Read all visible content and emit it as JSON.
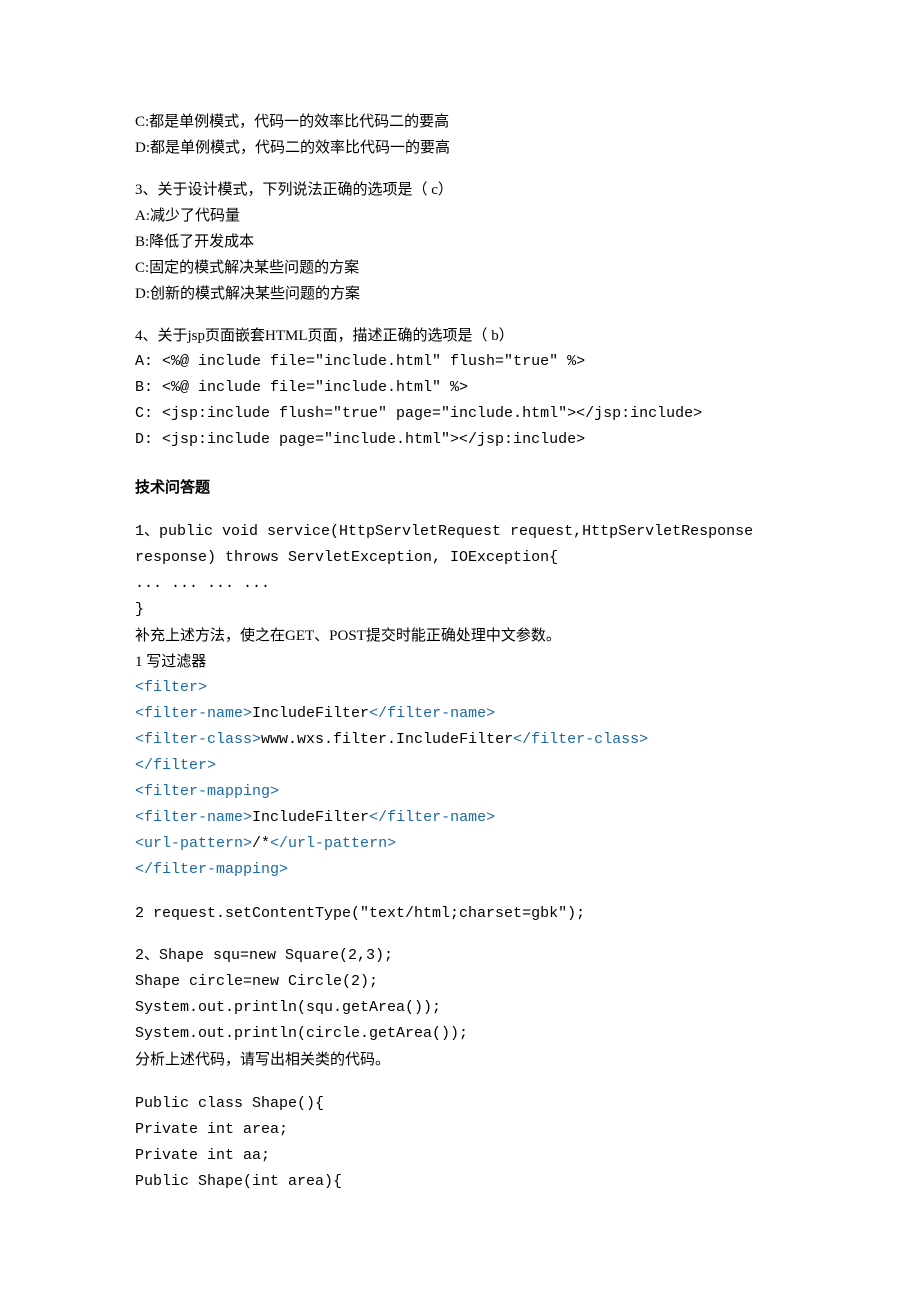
{
  "q_pre": {
    "c": "C:都是单例模式，代码一的效率比代码二的要高",
    "d": "D:都是单例模式，代码二的效率比代码一的要高"
  },
  "q3": {
    "stem": "3、关于设计模式，下列说法正确的选项是（ c）",
    "a": "A:减少了代码量",
    "b": "B:降低了开发成本",
    "c": "C:固定的模式解决某些问题的方案",
    "d": "D:创新的模式解决某些问题的方案"
  },
  "q4": {
    "stem": "4、关于jsp页面嵌套HTML页面，描述正确的选项是（ b）",
    "a": "A: <%@ include file=\"include.html\" flush=\"true\" %>",
    "b": "B: <%@ include file=\"include.html\" %>",
    "c": "C: <jsp:include flush=\"true\" page=\"include.html\"></jsp:include>",
    "d": "D: <jsp:include page=\"include.html\"></jsp:include>"
  },
  "section_title": "技术问答题",
  "a1": {
    "line1": "1、public void service(HttpServletRequest request,HttpServletResponse",
    "line2": "response) throws ServletException, IOException{",
    "line3": "... ...  ... ...",
    "line4": "}",
    "line5": "补充上述方法，使之在GET、POST提交时能正确处理中文参数。",
    "line6": "1 写过滤器",
    "xml": {
      "l1o": "<filter>",
      "l2o": "<filter-name>",
      "l2t": "IncludeFilter",
      "l2c": "</filter-name>",
      "l3o": "<filter-class>",
      "l3t": "www.wxs.filter.IncludeFilter",
      "l3c": "</filter-class>",
      "l4c": "</filter>",
      "l5o": "<filter-mapping>",
      "l6o": "<filter-name>",
      "l6t": "IncludeFilter",
      "l6c": "</filter-name>",
      "l7o": "<url-pattern>",
      "l7t": "/*",
      "l7c": "</url-pattern>",
      "l8c": "</filter-mapping>"
    },
    "line_after": "2 request.setContentType(\"text/html;charset=gbk\");"
  },
  "a2": {
    "l1": "2、Shape squ=new Square(2,3);",
    "l2": "Shape circle=new Circle(2);",
    "l3": "System.out.println(squ.getArea());",
    "l4": "System.out.println(circle.getArea());",
    "l5": "分析上述代码，请写出相关类的代码。",
    "c1": "Public class Shape(){",
    "c2": "Private int area;",
    "c3": "Private int aa;",
    "c4": "Public Shape(int area){"
  }
}
